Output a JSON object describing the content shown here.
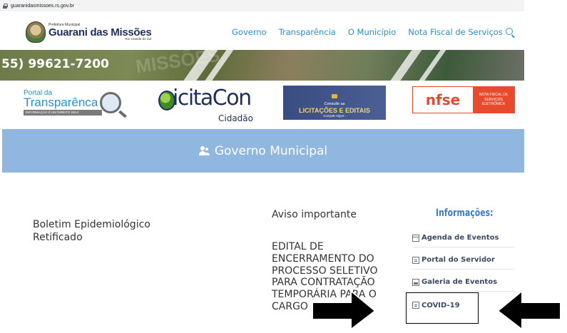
{
  "browser": {
    "url": "guaranidasmissoes.rs.gov.br"
  },
  "header": {
    "logo_small": "Prefeitura Municipal",
    "logo_name": "Guarani das Missões",
    "logo_sub": "Rio Grande do Sul",
    "nav": [
      "Governo",
      "Transparência",
      "O Município",
      "Nota Fiscal de Serviços"
    ]
  },
  "banner": {
    "phone": "55) 99621-7200",
    "faded_text": "MISSÕES"
  },
  "logos": {
    "portal_line1": "Portal da",
    "portal_line2": "Transparênc",
    "portal_line2b": "a",
    "portal_tagline": "INFORMAÇÃO É UM DIREITO SEU!",
    "licitacon_name": "icitaCon",
    "licitacon_sub": "Cidadão",
    "licit_line1": "Consulte as",
    "licit_line2": "LICITAÇÕES E EDITAIS",
    "licit_line3": "CLIQUE AQUI ›",
    "nfse_left": "nfse",
    "nfse_right": "NOTA FISCAL DE SERVIÇOS ELETRÔNICA"
  },
  "band": {
    "title": "Governo Municipal"
  },
  "main": {
    "boletim": "Boletim Epidemiológico Retificado",
    "aviso": "Aviso importante",
    "edital": "EDITAL DE ENCERRAMENTO DO PROCESSO SELETIVO PARA CONTRATAÇÃO TEMPORÁRIA PARA O CARGO"
  },
  "sidebar": {
    "title": "Informações:",
    "items": [
      {
        "label": "Agenda de Eventos",
        "icon": "calendar-icon"
      },
      {
        "label": "Portal do Servidor",
        "icon": "document-icon"
      },
      {
        "label": "Galeria de Eventos",
        "icon": "gallery-icon"
      },
      {
        "label": "COVID-19",
        "icon": "document-icon"
      }
    ]
  },
  "colors": {
    "accent": "#2a8fd4",
    "band": "#8fb7e0",
    "nfse": "#e84a2e",
    "navy": "#1f2e5a"
  }
}
